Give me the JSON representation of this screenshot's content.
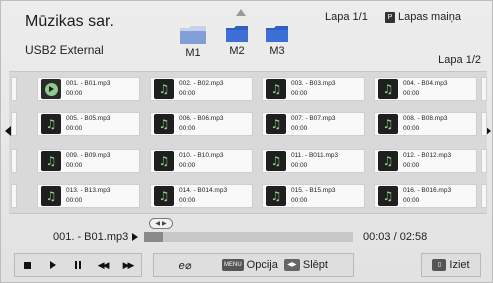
{
  "header": {
    "title": "Mūzikas sar.",
    "device": "USB2 External",
    "page_info": "Lapa 1/1",
    "page_change_label": "Lapas maiņa",
    "page_change_icon": "P",
    "row_page": "Lapa 1/2"
  },
  "folders": [
    {
      "label": "M1",
      "icon": "folder-icon"
    },
    {
      "label": "M2",
      "icon": "folder-icon"
    },
    {
      "label": "M3",
      "icon": "folder-icon"
    }
  ],
  "files": [
    {
      "name": "001. - B01.mp3",
      "time": "00:00",
      "playing": true
    },
    {
      "name": "002. - B02.mp3",
      "time": "00:00"
    },
    {
      "name": "003. - B03.mp3",
      "time": "00:00"
    },
    {
      "name": "004. - B04.mp3",
      "time": "00:00"
    },
    {
      "name": "005. - B05.mp3",
      "time": "00:00"
    },
    {
      "name": "006. - B06.mp3",
      "time": "00:00"
    },
    {
      "name": "007. - B07.mp3",
      "time": "00:00"
    },
    {
      "name": "008. - B08.mp3",
      "time": "00:00"
    },
    {
      "name": "009. - B09.mp3",
      "time": "00:00"
    },
    {
      "name": "010. - B10.mp3",
      "time": "00:00"
    },
    {
      "name": "011. - B011.mp3",
      "time": "00:00"
    },
    {
      "name": "012. - B012.mp3",
      "time": "00:00"
    },
    {
      "name": "013. - B13.mp3",
      "time": "00:00"
    },
    {
      "name": "014. - B014.mp3",
      "time": "00:00"
    },
    {
      "name": "015. - B15.mp3",
      "time": "00:00"
    },
    {
      "name": "016. - B016.mp3",
      "time": "00:00"
    }
  ],
  "now_playing": {
    "track": "001. - B01.mp3",
    "time": "00:03 / 02:58",
    "progress": 0.09
  },
  "controls": {
    "stop": "stop-icon",
    "play": "play-icon",
    "pause": "pause-icon",
    "rewind": "rewind-icon",
    "forward": "fast-forward-icon"
  },
  "actions": {
    "eco_label": "e⌀",
    "option_key": "MENU",
    "option_label": "Opcija",
    "hide_key": "◀▶",
    "hide_label": "Slēpt",
    "exit_key": "▯",
    "exit_label": "Iziet"
  },
  "colors": {
    "folder": "#4a74c9",
    "thumb_bg": "#1f1f1f",
    "thumb_note": "#8fd98f"
  }
}
